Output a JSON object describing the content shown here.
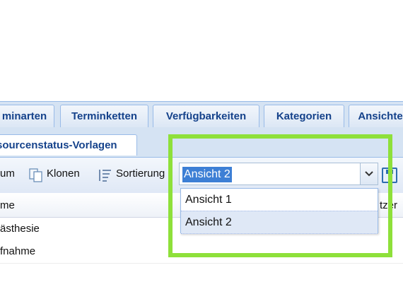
{
  "tabs_row1": [
    {
      "label": "minarten"
    },
    {
      "label": "Terminketten"
    },
    {
      "label": "Verfügbarkeiten"
    },
    {
      "label": "Kategorien"
    },
    {
      "label": "Ansichte"
    }
  ],
  "tabs_row2": [
    {
      "label": "sourcenstatus-Vorlagen"
    }
  ],
  "toolbar": {
    "item_partial_label": "um",
    "clone_label": "Klonen",
    "sort_label": "Sortierung"
  },
  "view_combo": {
    "value": "Ansicht 2",
    "options": [
      "Ansicht 1",
      "Ansicht 2"
    ],
    "selected_index": 1
  },
  "grid": {
    "header_name": "me",
    "header_right": "tzer",
    "rows": [
      {
        "name": "ästhesie"
      },
      {
        "name": "fnahme"
      }
    ]
  },
  "colors": {
    "highlight_border": "#8ee03a",
    "tab_text": "#15428b",
    "selection": "#3d7fd5"
  }
}
